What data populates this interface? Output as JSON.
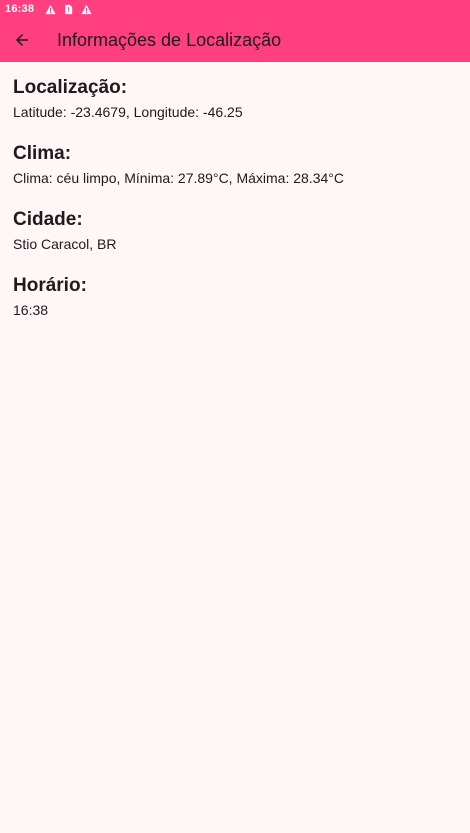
{
  "status_bar": {
    "time": "16:38",
    "icons": [
      "warning-icon",
      "sim-alert-icon",
      "warning-icon"
    ]
  },
  "app_bar": {
    "title": "Informações de Localização",
    "back_icon": "arrow-left-icon"
  },
  "sections": [
    {
      "title": "Localização:",
      "value": "Latitude: -23.4679, Longitude: -46.25"
    },
    {
      "title": "Clima:",
      "value": "Clima: céu limpo, Mínima: 27.89°C, Máxima: 28.34°C"
    },
    {
      "title": "Cidade:",
      "value": "Stio Caracol, BR"
    },
    {
      "title": "Horário:",
      "value": "16:38"
    }
  ],
  "colors": {
    "accent": "#ff3f7f",
    "background": "#fff6f6",
    "text": "#1e1a1d"
  }
}
